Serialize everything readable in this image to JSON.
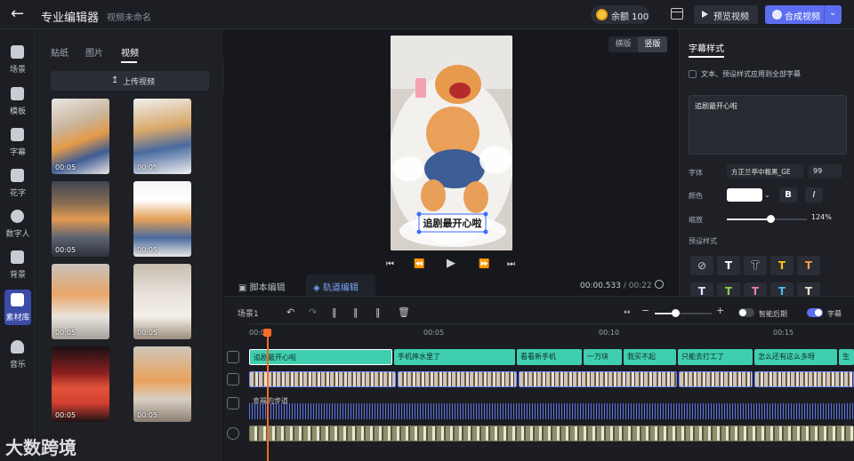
{
  "header": {
    "title": "专业编辑器",
    "subtitle": "视频未命名",
    "balance": "余额 100",
    "preview_label": "预览视频",
    "compose_label": "合成视频"
  },
  "nav": [
    {
      "label": "场景"
    },
    {
      "label": "模板"
    },
    {
      "label": "字幕"
    },
    {
      "label": "花字"
    },
    {
      "label": "数字人"
    },
    {
      "label": "背景"
    },
    {
      "label": "素材库"
    },
    {
      "label": "音乐"
    }
  ],
  "assets": {
    "tabs": [
      "贴纸",
      "图片",
      "视频"
    ],
    "active_tab": "视频",
    "upload_label": "上传视频",
    "thumbs": [
      {
        "dur": "00:05"
      },
      {
        "dur": "00:05"
      },
      {
        "dur": "00:05"
      },
      {
        "dur": "00:05"
      },
      {
        "dur": "00:05"
      },
      {
        "dur": "00:05"
      },
      {
        "dur": "00:05"
      },
      {
        "dur": "00:05"
      }
    ]
  },
  "preview": {
    "orientation": [
      "横版",
      "竖版"
    ],
    "caption": "追剧最开心啦",
    "tabs": [
      "脚本编辑",
      "轨道编辑"
    ],
    "time_current": "00:00.533",
    "time_sep": "/",
    "time_total": "00:22"
  },
  "subtitle_style": {
    "title": "字幕样式",
    "apply_all": "文本、预设样式应用到全部字幕",
    "text": "追剧最开心啦",
    "font_label": "字体",
    "font_value": "方正兰亭中粗黑_GE",
    "size_value": "99",
    "color_label": "颜色",
    "bold": "B",
    "italic": "I",
    "scale_label": "缩放",
    "scale_value": "124%",
    "preset_label": "预设样式",
    "presets": [
      "⊘",
      "T",
      "T",
      "T",
      "T"
    ],
    "presets2": [
      "T",
      "T",
      "T",
      "T",
      "T"
    ]
  },
  "timeline": {
    "scene": "场景1",
    "smart_label": "智能后期",
    "subtitle_toggle": "字幕",
    "ruler": [
      "00:00",
      "00:05",
      "00:10",
      "00:15"
    ],
    "subtitles": [
      "追剧最开心啦",
      "手机摔水里了",
      "看看新手机",
      "一万块",
      "我买不起",
      "只能去打工了",
      "怎么还有这么多呀",
      "生"
    ],
    "audio_name": "幸福的步道"
  },
  "watermark": "大数跨境",
  "colors": {
    "accent": "#5b6ef0",
    "subtitle_clip": "#3fcfb0",
    "playhead": "#ff6a2a"
  }
}
